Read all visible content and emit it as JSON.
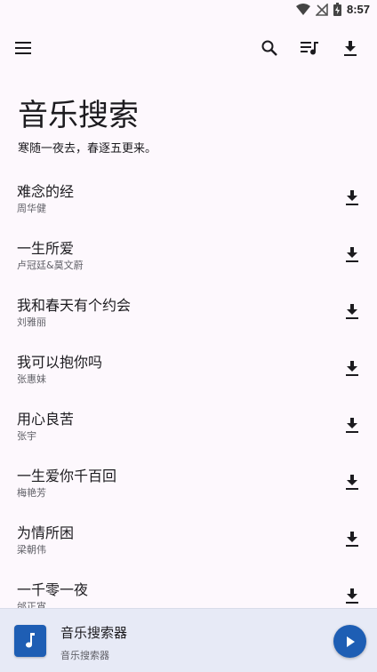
{
  "status_bar": {
    "time": "8:57"
  },
  "appbar": {
    "menu_icon": "hamburger-icon",
    "search_icon": "search-icon",
    "queue_icon": "queue-music-icon",
    "download_icon": "download-icon"
  },
  "header": {
    "title": "音乐搜索",
    "subtitle": "寒随一夜去，春逐五更来。"
  },
  "songs": [
    {
      "title": "难念的经",
      "artist": "周华健"
    },
    {
      "title": "一生所爱",
      "artist": "卢冠廷&莫文蔚"
    },
    {
      "title": "我和春天有个约会",
      "artist": "刘雅丽"
    },
    {
      "title": "我可以抱你吗",
      "artist": "张惠妹"
    },
    {
      "title": "用心良苦",
      "artist": "张宇"
    },
    {
      "title": "一生爱你千百回",
      "artist": "梅艳芳"
    },
    {
      "title": "为情所困",
      "artist": "梁朝伟"
    },
    {
      "title": "一千零一夜",
      "artist": "邰正宵"
    }
  ],
  "player": {
    "title": "音乐搜索器",
    "subtitle": "音乐搜索器",
    "art_icon": "music-note-icon",
    "play_icon": "play-icon"
  },
  "colors": {
    "accent": "#1e5eb4",
    "background": "#fdf8fd",
    "player_bg": "#e7eaf6"
  }
}
